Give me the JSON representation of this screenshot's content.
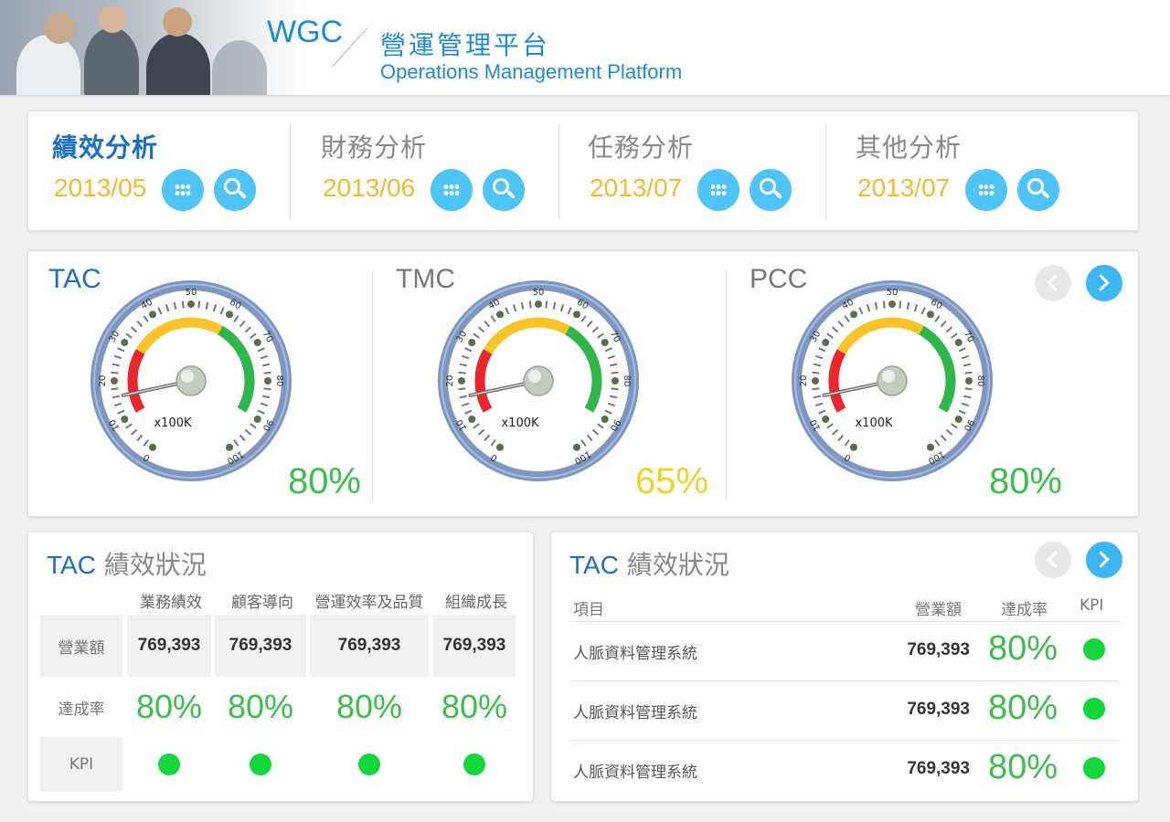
{
  "header": {
    "brand": "WGC",
    "title_zh": "營運管理平台",
    "title_en": "Operations Management Platform"
  },
  "categories": [
    {
      "label": "績效分析",
      "date": "2013/05",
      "active": true
    },
    {
      "label": "財務分析",
      "date": "2013/06",
      "active": false
    },
    {
      "label": "任務分析",
      "date": "2013/07",
      "active": false
    },
    {
      "label": "其他分析",
      "date": "2013/07",
      "active": false
    }
  ],
  "gauges": [
    {
      "title": "TAC",
      "value": 80,
      "value_label": "80%",
      "color": "#3bbf4a",
      "active": true
    },
    {
      "title": "TMC",
      "value": 65,
      "value_label": "65%",
      "color": "#f5cf2a",
      "active": false
    },
    {
      "title": "PCC",
      "value": 80,
      "value_label": "80%",
      "color": "#3bbf4a",
      "active": false
    }
  ],
  "gauge_scale": {
    "ticks": [
      "0",
      "10",
      "20",
      "30",
      "40",
      "50",
      "60",
      "70",
      "80",
      "90",
      "100"
    ],
    "unit": "x100K",
    "min": 0,
    "max": 100,
    "needle_value": 16
  },
  "colors": {
    "accent": "#1a6fc4",
    "date": "#f6b930",
    "button": "#4ec4f8",
    "success": "#3bbf4a",
    "kpi_green": "#13d63b",
    "gauge_red": "#e8262b",
    "gauge_yellow": "#f9c32a",
    "gauge_green": "#2fb64b"
  },
  "left_table": {
    "title_a": "TAC",
    "title_b": "績效狀況",
    "columns": [
      "業務績效",
      "顧客導向",
      "營運效率及品質",
      "組織成長"
    ],
    "rows": [
      {
        "label": "營業額",
        "values": [
          "769,393",
          "769,393",
          "769,393",
          "769,393"
        ]
      },
      {
        "label": "達成率",
        "values": [
          "80%",
          "80%",
          "80%",
          "80%"
        ]
      },
      {
        "label": "KPI",
        "values": [
          "green",
          "green",
          "green",
          "green"
        ]
      }
    ]
  },
  "right_table": {
    "title_a": "TAC",
    "title_b": "績效狀況",
    "headers": {
      "item": "項目",
      "revenue": "營業額",
      "rate": "達成率",
      "kpi": "KPI"
    },
    "rows": [
      {
        "name": "人脈資料管理系統",
        "revenue": "769,393",
        "rate": "80%",
        "kpi": "green"
      },
      {
        "name": "人脈資料管理系統",
        "revenue": "769,393",
        "rate": "80%",
        "kpi": "green"
      },
      {
        "name": "人脈資料管理系統",
        "revenue": "769,393",
        "rate": "80%",
        "kpi": "green"
      }
    ]
  }
}
